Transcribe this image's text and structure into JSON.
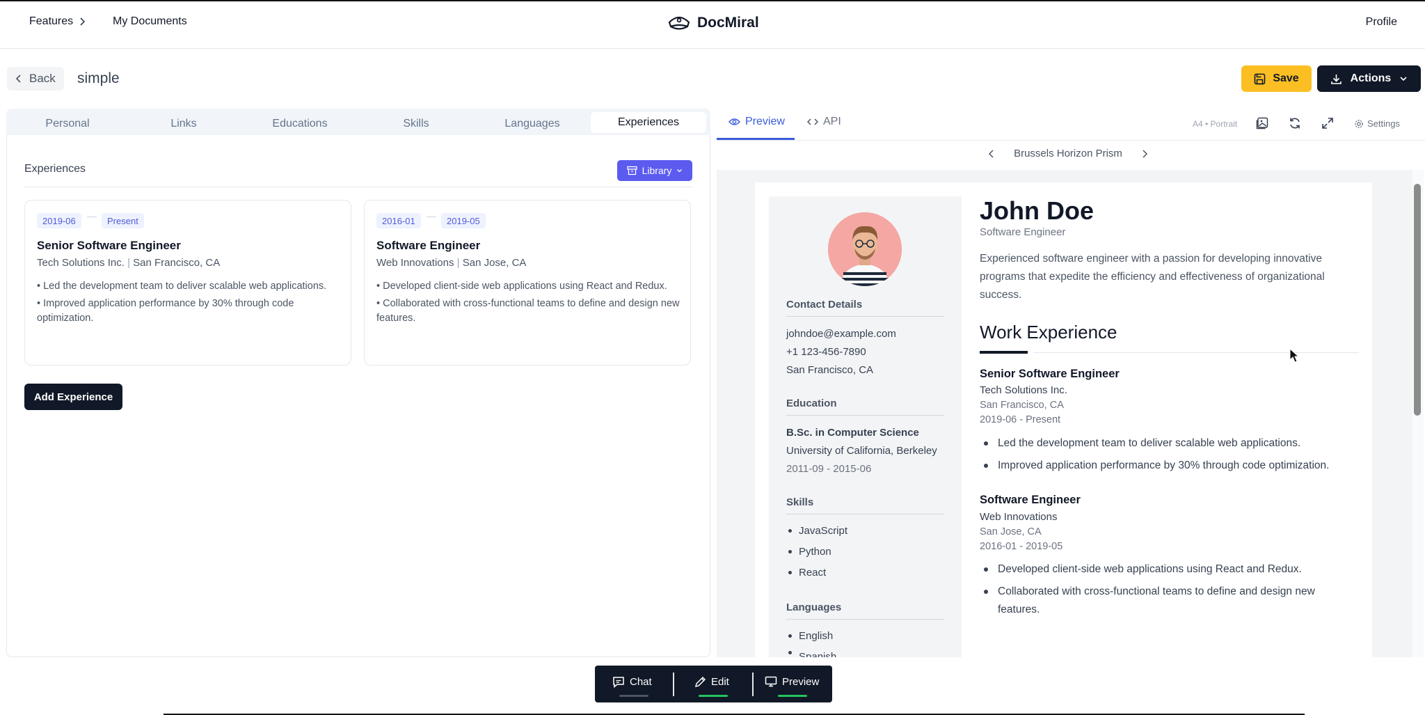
{
  "nav": {
    "features": "Features",
    "my_documents": "My Documents",
    "brand": "DocMiral",
    "profile": "Profile"
  },
  "toolbar": {
    "back": "Back",
    "doc_title": "simple",
    "save": "Save",
    "actions": "Actions"
  },
  "editor": {
    "tabs": [
      "Personal",
      "Links",
      "Educations",
      "Skills",
      "Languages",
      "Experiences"
    ],
    "active_tab": "Experiences",
    "section_title": "Experiences",
    "library": "Library",
    "add_button": "Add Experience",
    "experiences": [
      {
        "start": "2019-06",
        "end": "Present",
        "title": "Senior Software Engineer",
        "company": "Tech Solutions Inc.",
        "location": "San Francisco, CA",
        "bullets": [
          "• Led the development team to deliver scalable web applications.",
          "• Improved application performance by 30% through code optimization."
        ]
      },
      {
        "start": "2016-01",
        "end": "2019-05",
        "title": "Software Engineer",
        "company": "Web Innovations",
        "location": "San Jose, CA",
        "bullets": [
          "• Developed client-side web applications using React and Redux.",
          "• Collaborated with cross-functional teams to define and design new features."
        ]
      }
    ]
  },
  "preview_panel": {
    "tabs": {
      "preview": "Preview",
      "api": "API"
    },
    "page_format": "A4 • Portrait",
    "settings": "Settings",
    "template_name": "Brussels Horizon Prism"
  },
  "resume": {
    "name": "John Doe",
    "role": "Software Engineer",
    "summary": "Experienced software engineer with a passion for developing innovative programs that expedite the efficiency and effectiveness of organizational success.",
    "contact": {
      "heading": "Contact Details",
      "email": "johndoe@example.com",
      "phone": "+1 123-456-7890",
      "location": "San Francisco, CA"
    },
    "education": {
      "heading": "Education",
      "degree": "B.Sc. in Computer Science",
      "school": "University of California, Berkeley",
      "dates": "2011-09 - 2015-06"
    },
    "skills": {
      "heading": "Skills",
      "items": [
        "JavaScript",
        "Python",
        "React"
      ]
    },
    "languages": {
      "heading": "Languages",
      "items": [
        "English",
        "Spanish"
      ]
    },
    "work_heading": "Work Experience",
    "jobs": [
      {
        "title": "Senior Software Engineer",
        "company": "Tech Solutions Inc.",
        "location": "San Francisco, CA",
        "dates": "2019-06 - Present",
        "bullets": [
          "Led the development team to deliver scalable web applications.",
          "Improved application performance by 30% through code optimization."
        ]
      },
      {
        "title": "Software Engineer",
        "company": "Web Innovations",
        "location": "San Jose, CA",
        "dates": "2016-01 - 2019-05",
        "bullets": [
          "Developed client-side web applications using React and Redux.",
          "Collaborated with cross-functional teams to define and design new features."
        ]
      }
    ]
  },
  "bottom_bar": {
    "chat": "Chat",
    "edit": "Edit",
    "preview": "Preview",
    "active_color": "#22c55e",
    "inactive_color": "#4b5563"
  }
}
